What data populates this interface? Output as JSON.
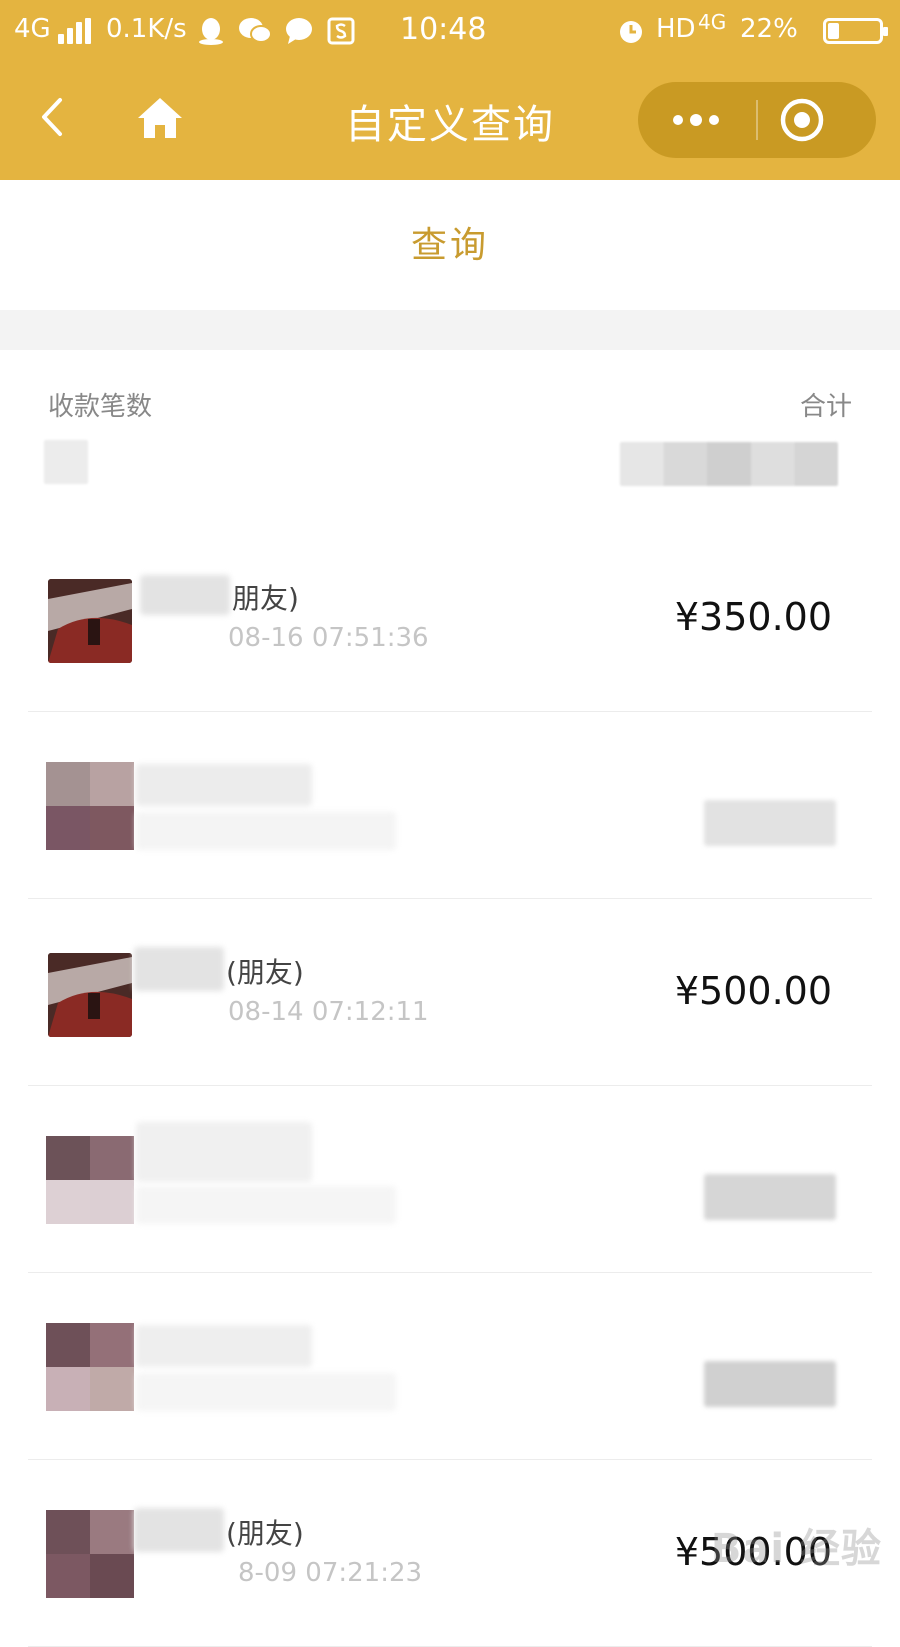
{
  "status_bar": {
    "network": "4G",
    "speed": "0.1K/s",
    "time": "10:48",
    "right_indicators": "HD",
    "network_right": "4G",
    "battery": "22%"
  },
  "nav": {
    "title": "自定义查询"
  },
  "query_button": "查询",
  "summary": {
    "count_label": "收款笔数",
    "total_label": "合计"
  },
  "transactions": [
    {
      "name_suffix": "朋友)",
      "time": "08-16 07:51:36",
      "amount": "¥350.00"
    },
    {
      "name_suffix": "",
      "time": "",
      "amount": ""
    },
    {
      "name_suffix": "(朋友)",
      "time": "08-14 07:12:11",
      "amount": "¥500.00"
    },
    {
      "name_suffix": "",
      "time": "",
      "amount": ""
    },
    {
      "name_suffix": "",
      "time": "",
      "amount": ""
    },
    {
      "name_suffix": "(朋友)",
      "time": "8-09 07:21:23",
      "amount": "¥500.00"
    }
  ],
  "watermark": "Bai 经验",
  "colors": {
    "brand": "#e4b440",
    "capsule": "#c99a23",
    "query_text": "#c89b2f"
  }
}
